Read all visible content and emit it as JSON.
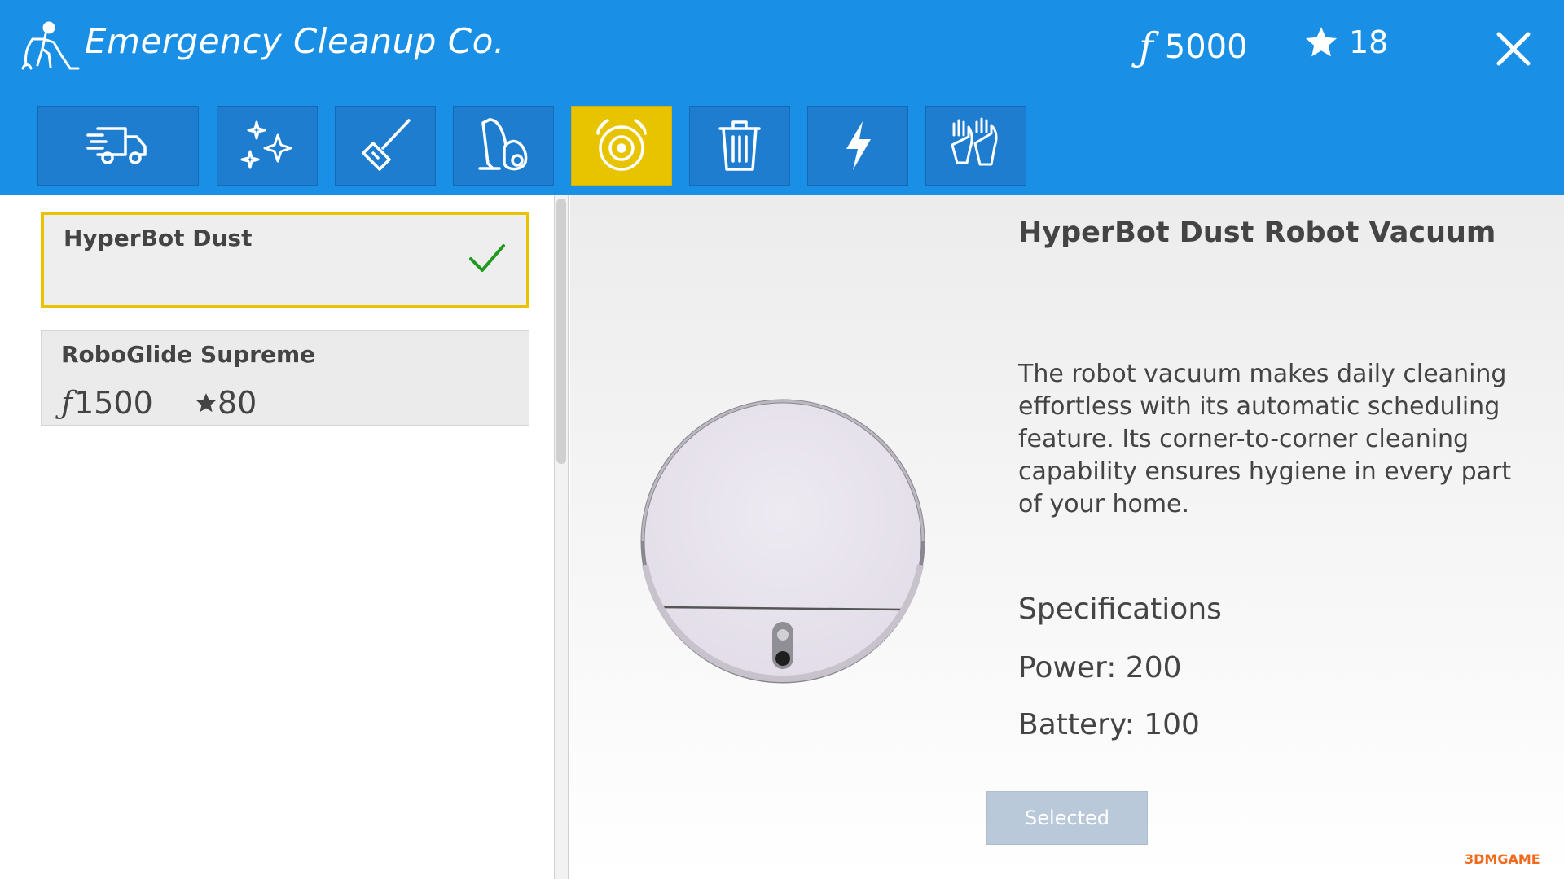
{
  "header": {
    "title": "Emergency Cleanup Co.",
    "currency_symbol": "ƒ",
    "money": "5000",
    "stars": "18",
    "color": "#1a8fe6"
  },
  "tabs": [
    {
      "icon": "delivery-truck-icon",
      "active": false
    },
    {
      "icon": "sparkles-icon",
      "active": false
    },
    {
      "icon": "mop-icon",
      "active": false
    },
    {
      "icon": "vacuum-cleaner-icon",
      "active": false
    },
    {
      "icon": "robot-vacuum-icon",
      "active": true
    },
    {
      "icon": "trash-bin-icon",
      "active": false
    },
    {
      "icon": "lightning-icon",
      "active": false
    },
    {
      "icon": "gloves-icon",
      "active": false
    }
  ],
  "items": [
    {
      "name": "HyperBot Dust",
      "selected": true
    },
    {
      "name": "RoboGlide Supreme",
      "price_symbol": "ƒ",
      "price": "1500",
      "rating": "80",
      "selected": false
    }
  ],
  "details": {
    "title": "HyperBot Dust Robot Vacuum",
    "description": "The robot vacuum makes daily cleaning effortless with its automatic scheduling feature. Its corner-to-corner cleaning capability ensures hygiene in every part of your home.",
    "specs_heading": "Specifications",
    "power": "Power: 200",
    "battery": "Battery: 100",
    "button_label": "Selected"
  },
  "watermark": "3DMGAME",
  "colors": {
    "accent": "#e8c400",
    "tab": "#1f7dd0",
    "check": "#1f9a1f"
  }
}
